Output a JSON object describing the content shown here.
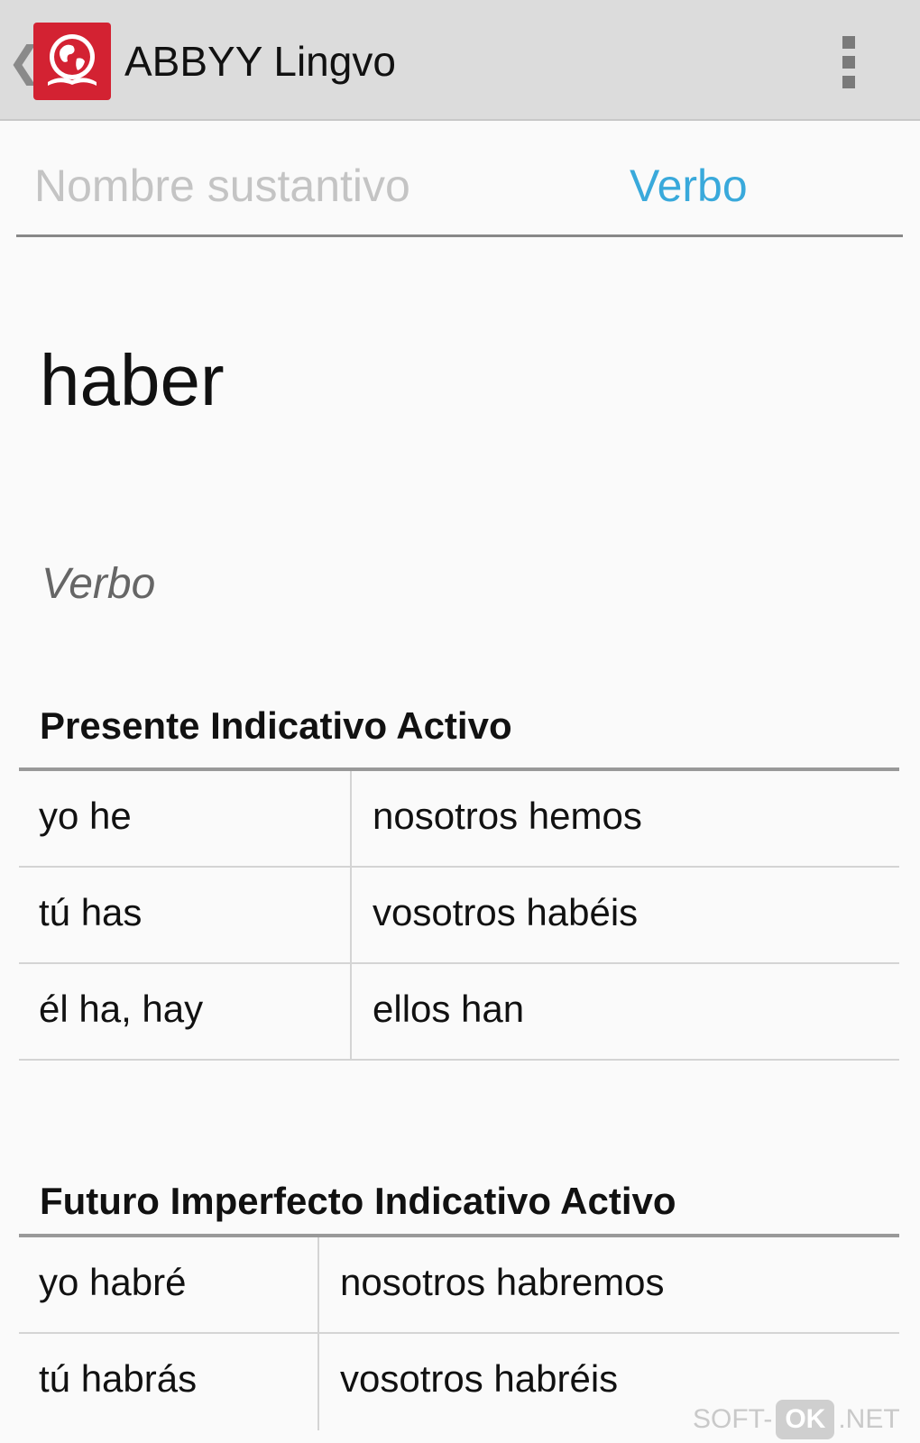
{
  "actionbar": {
    "title": "ABBYY Lingvo",
    "back_icon": "chevron-left-icon",
    "app_icon": "lingvo-globe-book-icon",
    "menu_icon": "overflow-menu-icon",
    "brand_color": "#d32232"
  },
  "tabs": [
    {
      "label": "Nombre sustantivo",
      "selected": false
    },
    {
      "label": "Verbo",
      "selected": true
    }
  ],
  "accent_color": "#39a9db",
  "entry": {
    "word": "haber",
    "part_of_speech": "Verbo"
  },
  "sections": [
    {
      "title": "Presente Indicativo Activo",
      "rows": [
        [
          "yo he",
          "nosotros hemos"
        ],
        [
          "tú has",
          "vosotros habéis"
        ],
        [
          "él ha, hay",
          "ellos han"
        ]
      ]
    },
    {
      "title": "Futuro Imperfecto Indicativo Activo",
      "rows": [
        [
          "yo habré",
          "nosotros habremos"
        ],
        [
          "tú habrás",
          "vosotros habréis"
        ]
      ]
    }
  ],
  "watermark": {
    "prefix": "SOFT-",
    "badge": "OK",
    "suffix": ".NET"
  }
}
